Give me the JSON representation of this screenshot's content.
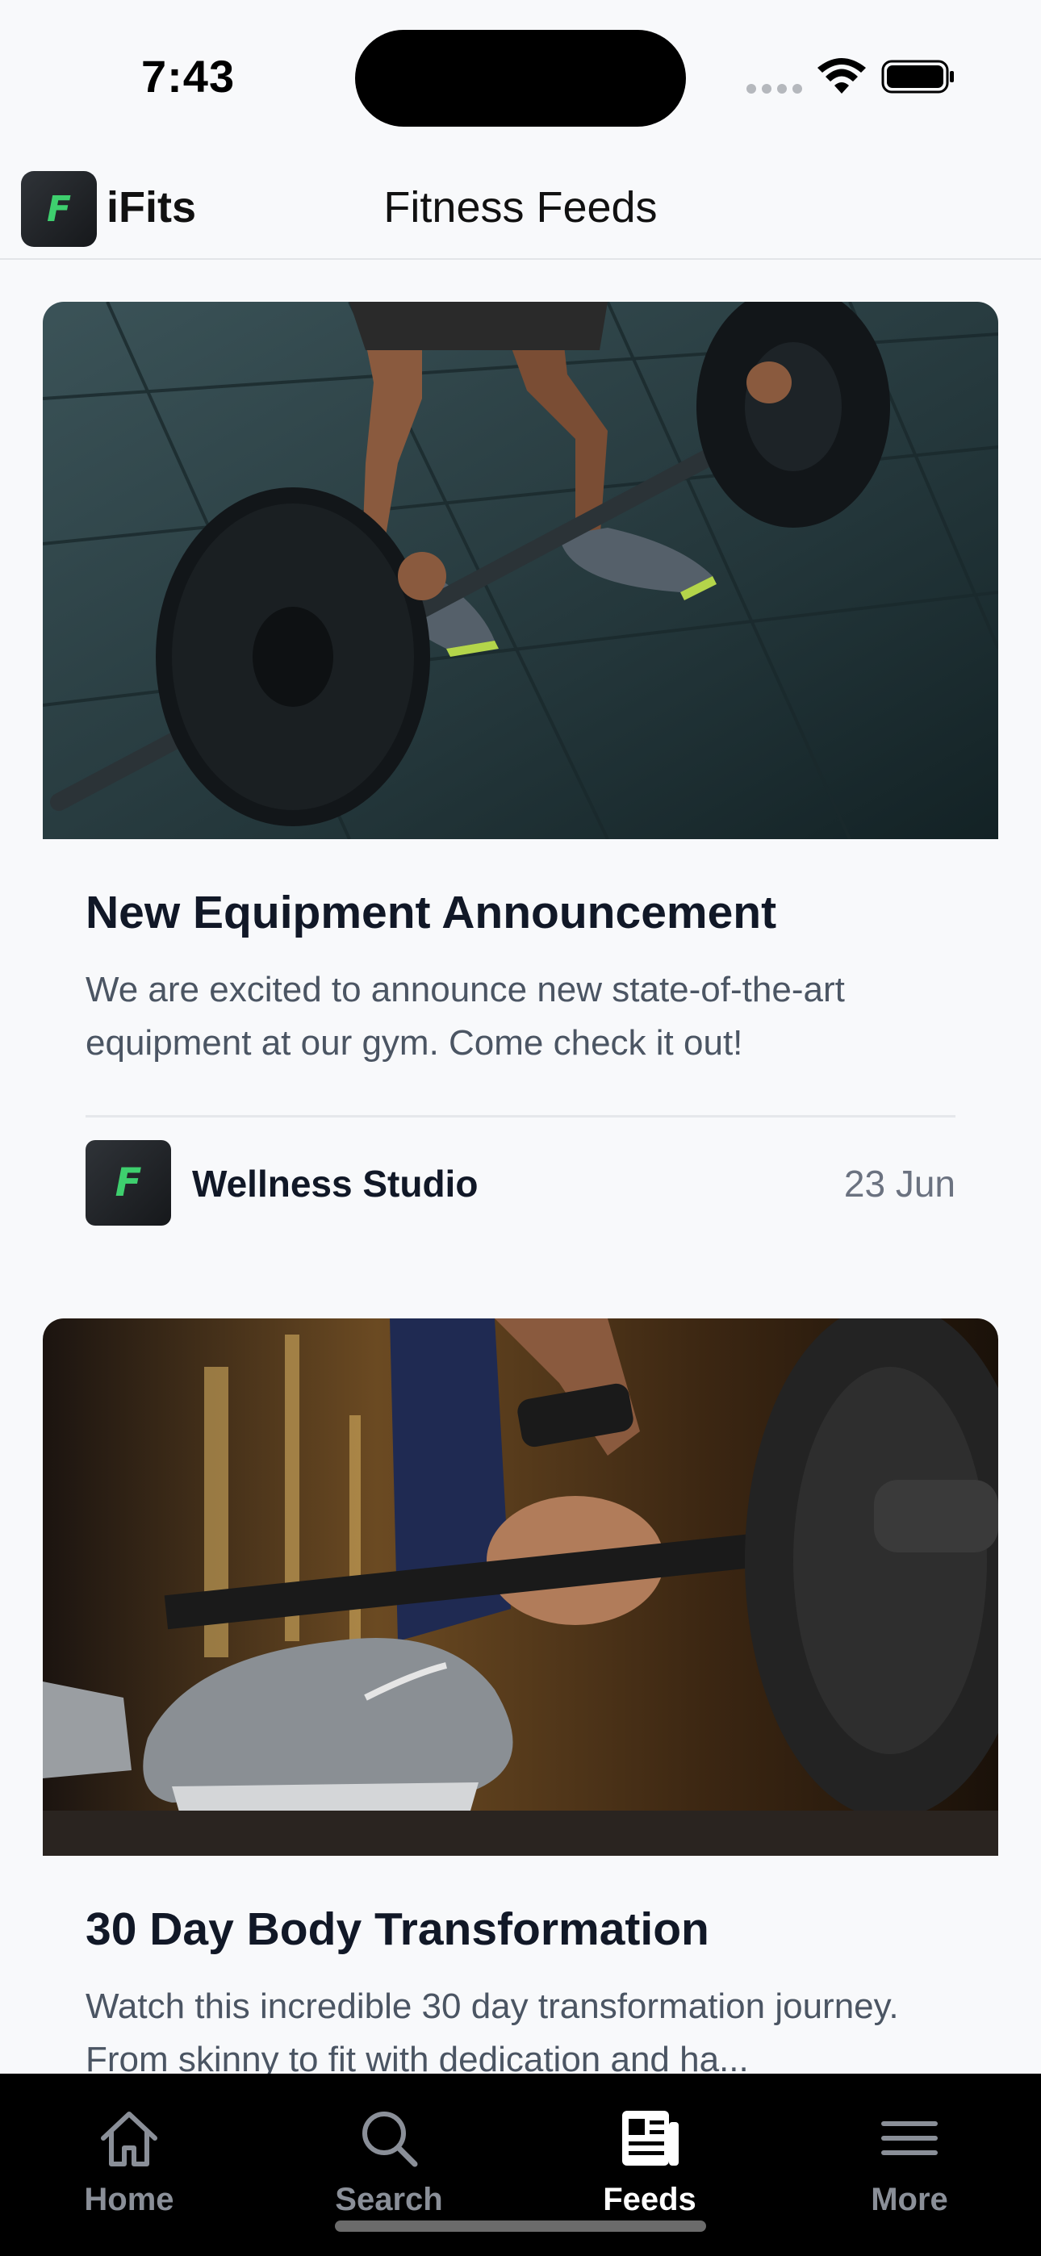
{
  "status_bar": {
    "time": "7:43"
  },
  "header": {
    "app_name": "iFits",
    "title": "Fitness Feeds",
    "logo_letter": "F"
  },
  "feed": {
    "posts": [
      {
        "image": "barbell-deadlift-photo",
        "title": "New Equipment Announcement",
        "description": "We are excited to announce new state-of-the-art equipment at our gym. Come check it out!",
        "author": "Wellness Studio",
        "date": "23 Jun"
      },
      {
        "image": "barbell-grip-sneaker-photo",
        "title": "30 Day Body Transformation",
        "description": "Watch this incredible 30 day transformation journey. From skinny to fit with dedication and ha..."
      }
    ]
  },
  "tab_bar": {
    "tabs": [
      {
        "label": "Home",
        "icon": "home-icon",
        "active": false
      },
      {
        "label": "Search",
        "icon": "search-icon",
        "active": false
      },
      {
        "label": "Feeds",
        "icon": "newspaper-icon",
        "active": true
      },
      {
        "label": "More",
        "icon": "menu-icon",
        "active": false
      }
    ]
  },
  "colors": {
    "accent": "#3ecf6e",
    "tab_bar_bg": "#000000",
    "inactive_tab": "#8a8f98"
  }
}
